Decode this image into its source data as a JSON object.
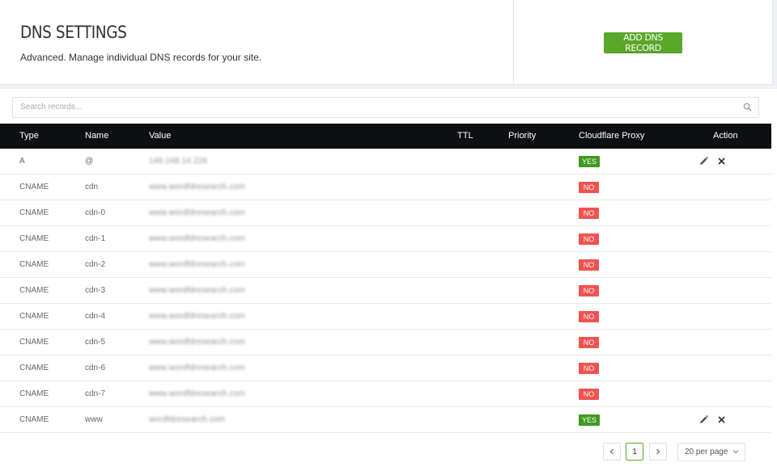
{
  "header": {
    "title": "DNS SETTINGS",
    "subtitle": "Advanced. Manage individual DNS records for your site.",
    "add_button": "ADD DNS RECORD"
  },
  "search": {
    "placeholder": "Search records...",
    "value": "",
    "icon": "search-icon"
  },
  "table": {
    "columns": [
      "Type",
      "Name",
      "Value",
      "TTL",
      "Priority",
      "Cloudflare Proxy",
      "Action"
    ],
    "rows": [
      {
        "type": "A",
        "name": "@",
        "value": "149.248.14.226",
        "ttl": "",
        "priority": "",
        "proxy": "YES",
        "actions": true
      },
      {
        "type": "CNAME",
        "name": "cdn",
        "value": "www.wordfdresearch.com",
        "ttl": "",
        "priority": "",
        "proxy": "NO",
        "actions": false
      },
      {
        "type": "CNAME",
        "name": "cdn-0",
        "value": "www.wordfdresearch.com",
        "ttl": "",
        "priority": "",
        "proxy": "NO",
        "actions": false
      },
      {
        "type": "CNAME",
        "name": "cdn-1",
        "value": "www.wordfdresearch.com",
        "ttl": "",
        "priority": "",
        "proxy": "NO",
        "actions": false
      },
      {
        "type": "CNAME",
        "name": "cdn-2",
        "value": "www.wordfdresearch.com",
        "ttl": "",
        "priority": "",
        "proxy": "NO",
        "actions": false
      },
      {
        "type": "CNAME",
        "name": "cdn-3",
        "value": "www.wordfdresearch.com",
        "ttl": "",
        "priority": "",
        "proxy": "NO",
        "actions": false
      },
      {
        "type": "CNAME",
        "name": "cdn-4",
        "value": "www.wordfdresearch.com",
        "ttl": "",
        "priority": "",
        "proxy": "NO",
        "actions": false
      },
      {
        "type": "CNAME",
        "name": "cdn-5",
        "value": "www.wordfdresearch.com",
        "ttl": "",
        "priority": "",
        "proxy": "NO",
        "actions": false
      },
      {
        "type": "CNAME",
        "name": "cdn-6",
        "value": "www.wordfdresearch.com",
        "ttl": "",
        "priority": "",
        "proxy": "NO",
        "actions": false
      },
      {
        "type": "CNAME",
        "name": "cdn-7",
        "value": "www.wordfdresearch.com",
        "ttl": "",
        "priority": "",
        "proxy": "NO",
        "actions": false
      },
      {
        "type": "CNAME",
        "name": "www",
        "value": "wordfdresearch.com",
        "ttl": "",
        "priority": "",
        "proxy": "YES",
        "actions": true
      }
    ]
  },
  "pagination": {
    "prev_icon": "chevron-left-icon",
    "current_page": "1",
    "next_icon": "chevron-right-icon",
    "per_page": "20 per page"
  },
  "colors": {
    "accent": "#5aa72a",
    "yes": "#3f9a1f",
    "no": "#ef5350",
    "table_header": "#0d0f12"
  }
}
